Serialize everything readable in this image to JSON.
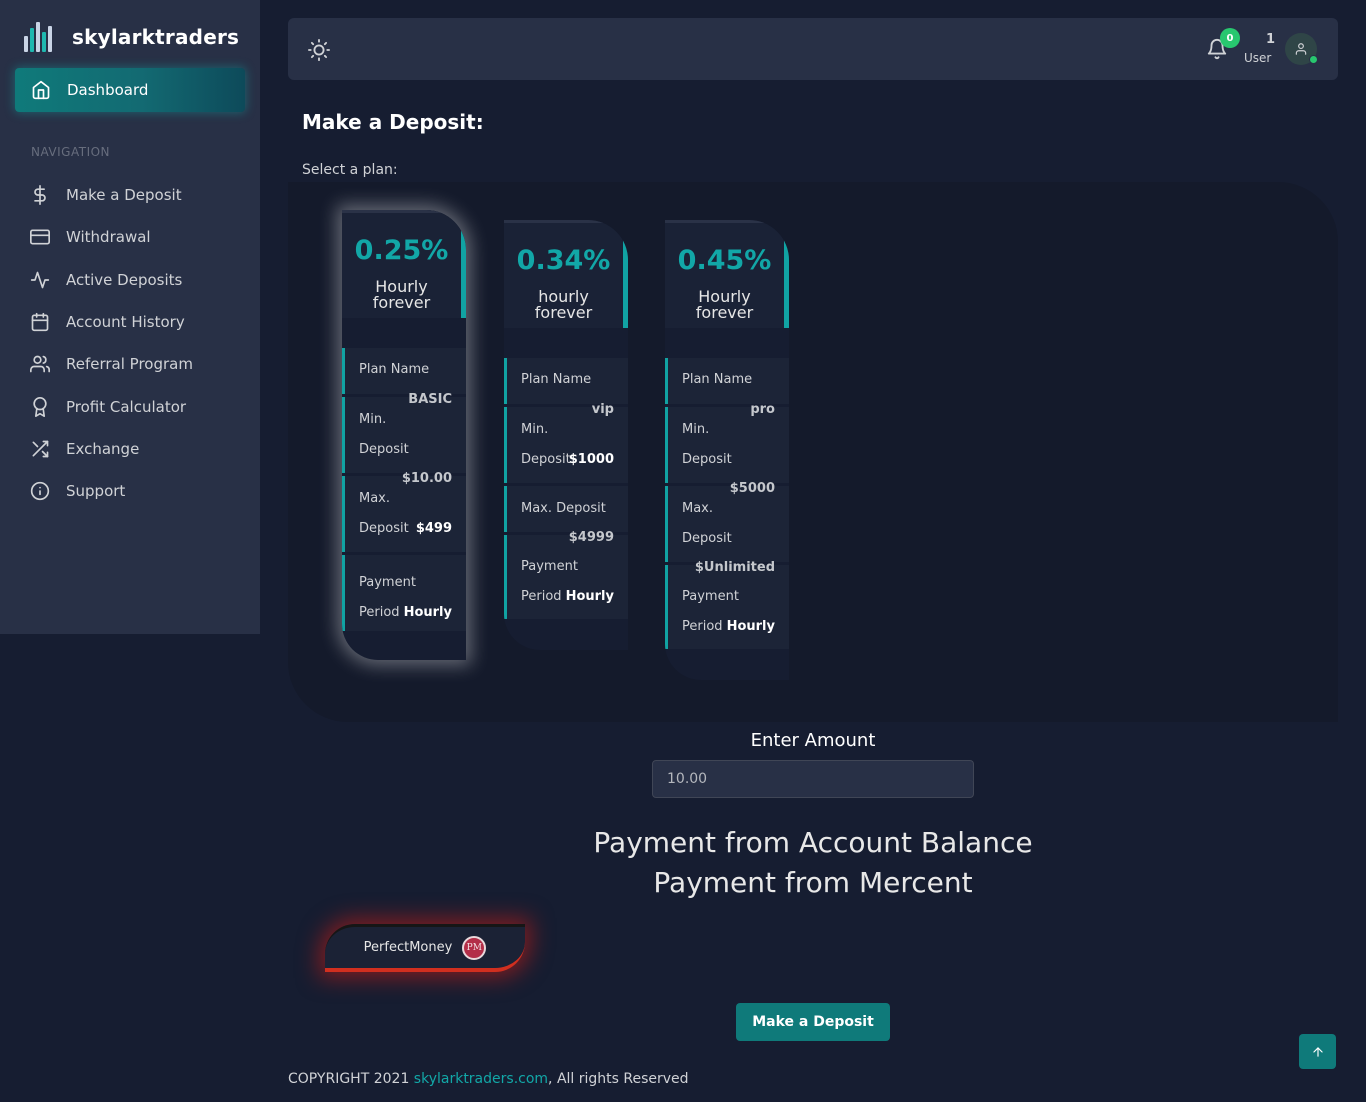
{
  "brand": {
    "name": "skylarktraders"
  },
  "sidebar": {
    "dashboard_label": "Dashboard",
    "nav_header": "NAVIGATION",
    "items": [
      {
        "label": "Make a Deposit",
        "icon": "dollar-icon"
      },
      {
        "label": "Withdrawal",
        "icon": "credit-card-icon"
      },
      {
        "label": "Active Deposits",
        "icon": "activity-icon"
      },
      {
        "label": "Account History",
        "icon": "calendar-icon"
      },
      {
        "label": "Referral Program",
        "icon": "users-icon"
      },
      {
        "label": "Profit Calculator",
        "icon": "award-icon"
      },
      {
        "label": "Exchange",
        "icon": "shuffle-icon"
      },
      {
        "label": "Support",
        "icon": "info-icon"
      }
    ]
  },
  "topbar": {
    "notification_count": "0",
    "user_number": "1",
    "user_role": "User"
  },
  "main": {
    "title": "Make a Deposit:",
    "select_plan_label": "Select a plan:",
    "plans": [
      {
        "rate": "0.25%",
        "desc_line1": "Hourly",
        "desc_line2": "forever",
        "plan_name_label": "Plan Name",
        "plan_name": "BASIC",
        "min_label_1": "Min.",
        "min_label_2": "Deposit",
        "min_value": "$10.00",
        "max_label_1": "Max.",
        "max_label_2": "Deposit",
        "max_value": "$499",
        "period_label_1": "Payment",
        "period_label_2": "Period",
        "period_value": "Hourly"
      },
      {
        "rate": "0.34%",
        "desc_line1": "hourly",
        "desc_line2": "forever",
        "plan_name_label": "Plan Name",
        "plan_name": "vip",
        "min_label_1": "Min.",
        "min_label_2": "Deposit",
        "min_value": "$1000",
        "max_label_1": "Max. Deposit",
        "max_value": "$4999",
        "period_label_1": "Payment",
        "period_label_2": "Period",
        "period_value": "Hourly"
      },
      {
        "rate": "0.45%",
        "desc_line1": "Hourly",
        "desc_line2": "forever",
        "plan_name_label": "Plan Name",
        "plan_name": "pro",
        "min_label_1": "Min.",
        "min_label_2": "Deposit",
        "min_value": "$5000",
        "max_label_1": "Max.",
        "max_label_2": "Deposit",
        "max_value": "$Unlimited",
        "period_label_1": "Payment",
        "period_label_2": "Period",
        "period_value": "Hourly"
      }
    ],
    "amount_label": "Enter Amount",
    "amount_value": "10.00",
    "payment_balance": "Payment from Account Balance",
    "payment_merchant": "Payment from Mercent",
    "processor_label": "PerfectMoney",
    "processor_logo_text": "PM",
    "submit_label": "Make a Deposit"
  },
  "footer": {
    "prefix": "COPYRIGHT 2021 ",
    "link": "skylarktraders.com",
    "suffix": ", All rights Reserved"
  },
  "colors": {
    "accent": "#0f7a7a",
    "teal_text": "#12a7a7",
    "background": "#161d31",
    "panel": "#283046",
    "success": "#28c76f",
    "perfectmoney_red": "#d12f1f"
  }
}
